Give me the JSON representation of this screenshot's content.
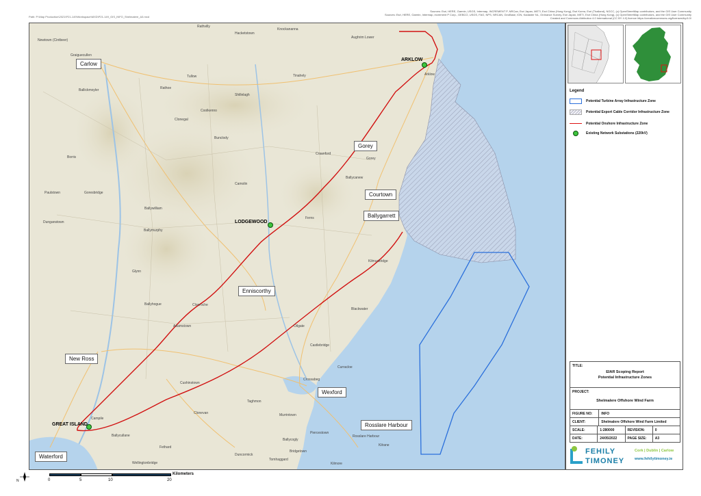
{
  "credits": {
    "line1": "Sources: Esri, HERE, Garmin, USGS, Intermap, INCREMENT P, NRCan, Esri Japan, METI, Esri China (Hong Kong), Esri Korea, Esri (Thailand), NGCC, (c) OpenStreetMap contributors, and the GIS User Community",
    "line2": "Sources: Esri, HERE, Garmin, Intermap, increment P Corp., GEBCO, USGS, FAO, NPS, NRCAN, GeoBase, IGN, Kadaster NL, Ordnance Survey, Esri Japan, METI, Esri China (Hong Kong), (c) OpenStreetMap contributors, and the GIS User Community",
    "line3": "Created and Commons Attribution 4.0 International (CC BY 4.0) licence https://creativecommons.org/licenses/by/4.0/"
  },
  "file_path": "Path: P:\\Map Production\\2021\\P21-149\\Workspace\\MXD\\P21-149_GIS_INFO_Shelmalere_A3.mxd",
  "map": {
    "towns": [
      {
        "name": "Rathvilly"
      },
      {
        "name": "Hacketstown"
      },
      {
        "name": "Knockananna"
      },
      {
        "name": "Aughrim Lower"
      },
      {
        "name": "Newtown (Cintbeer)"
      },
      {
        "name": "Graiguecullen"
      },
      {
        "name": "Tullow"
      },
      {
        "name": "Tinahely"
      },
      {
        "name": "Arklow"
      },
      {
        "name": "Ballickmoyler"
      },
      {
        "name": "Rathoe"
      },
      {
        "name": "Shillelagh"
      },
      {
        "name": "Coolkenno"
      },
      {
        "name": "Clonegal"
      },
      {
        "name": "Bunclody"
      },
      {
        "name": "Ferns"
      },
      {
        "name": "Camolin"
      },
      {
        "name": "Gorey"
      },
      {
        "name": "Craanford"
      },
      {
        "name": "Borris"
      },
      {
        "name": "Ballymurphy"
      },
      {
        "name": "Clonroche"
      },
      {
        "name": "Glynn"
      },
      {
        "name": "Taghmon"
      },
      {
        "name": "Murrintown"
      },
      {
        "name": "Rosslare Harbour"
      },
      {
        "name": "Campile"
      },
      {
        "name": "Fethard"
      },
      {
        "name": "Duncormick"
      },
      {
        "name": "Bridgetown"
      },
      {
        "name": "Kilmuckridge"
      },
      {
        "name": "Blackwater"
      },
      {
        "name": "Castlebridge"
      },
      {
        "name": "Oilgate"
      },
      {
        "name": "Ballycanew"
      },
      {
        "name": "Paulstown"
      },
      {
        "name": "Goresbridge"
      },
      {
        "name": "Dunganstown"
      },
      {
        "name": "Ballywilliam"
      },
      {
        "name": "Ballyhogue"
      },
      {
        "name": "Curracloe"
      },
      {
        "name": "Clonevan"
      },
      {
        "name": "Cushinstown"
      },
      {
        "name": "Adamstown"
      },
      {
        "name": "Wellingtonbridge"
      },
      {
        "name": "Kilmore"
      },
      {
        "name": "Ballycullane"
      },
      {
        "name": "Piercestown"
      },
      {
        "name": "Ballycogly"
      },
      {
        "name": "Crossabeg"
      },
      {
        "name": "Kilrane"
      },
      {
        "name": "Tomhaggard"
      }
    ],
    "callouts": {
      "carlow": "Carlow",
      "gorey": "Gorey",
      "courtown": "Courtown",
      "ballygarrett": "Ballygarrett",
      "enniscorthy": "Enniscorthy",
      "new_ross": "New Ross",
      "wexford": "Wexford",
      "rosslare": "Rosslare Harbour",
      "waterford": "Waterford"
    },
    "substations": {
      "arklow": "ARKLOW",
      "lodgewood": "LODGEWOOD",
      "great_island": "GREAT ISLAND"
    }
  },
  "legend": {
    "title": "Legend",
    "items": [
      {
        "label": "Potential Turbine Array Infrastructure Zone",
        "swatch": "blue-outline"
      },
      {
        "label": "Potential Export Cable Corridor Infrastructure Zone",
        "swatch": "hatch"
      },
      {
        "label": "Potential Onshore Infrastructure Zone",
        "swatch": "red-line"
      },
      {
        "label": "Existing Network Substations (220kV)",
        "swatch": "green-dot"
      }
    ]
  },
  "title_block": {
    "title_label": "TITLE:",
    "title_value_1": "EIAR Scoping Report",
    "title_value_2": "Potential Infrastructure Zones",
    "project_label": "PROJECT:",
    "project_value": "Shelmalere Offshore Wind Farm",
    "figure_label": "FIGURE NO:",
    "figure_value": "INFO",
    "client_label": "CLIENT:",
    "client_value": "Shelmalere Offshore Wind Farm Limited",
    "scale_label": "SCALE:",
    "scale_value": "1:280000",
    "revision_label": "REVISION:",
    "revision_value": "0",
    "date_label": "DATE:",
    "date_value": "24/05/2022",
    "pagesize_label": "PAGE SIZE:",
    "pagesize_value": "A3"
  },
  "logo": {
    "line1": "FEHILY",
    "line2": "TIMONEY",
    "offices": "Cork | Dublin | Carlow",
    "url": "www.fehilytimoney.ie"
  },
  "scalebar": {
    "ticks": [
      "0",
      "5",
      "10",
      "20"
    ],
    "unit": "Kilometers",
    "north": "N"
  },
  "colors": {
    "sea": "#b5d3ec",
    "land": "#e9e6d6",
    "onshore_route": "#d11111",
    "turbine_zone": "#2a6fdb",
    "substation": "#3ec43e"
  }
}
